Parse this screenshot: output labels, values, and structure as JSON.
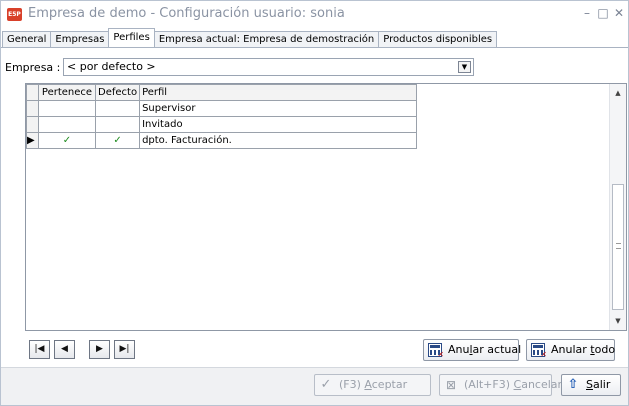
{
  "window": {
    "app_icon_text": "E5P",
    "title": "Empresa de demo - Configuración usuario: sonia",
    "minimize_glyph": "–",
    "maximize_glyph": "□",
    "close_glyph": "✕"
  },
  "tabs": [
    {
      "label": "General",
      "active": false
    },
    {
      "label": "Empresas",
      "active": false
    },
    {
      "label": "Perfiles",
      "active": true
    },
    {
      "label": "Empresa actual: Empresa de demostración",
      "active": false
    },
    {
      "label": "Productos disponibles",
      "active": false
    }
  ],
  "filter": {
    "label": "Empresa :",
    "value": "< por defecto >"
  },
  "grid": {
    "columns": [
      "Pertenece",
      "Defecto",
      "Perfil"
    ],
    "rows": [
      {
        "pertenece": "",
        "defecto": "",
        "perfil": "Supervisor",
        "current": false
      },
      {
        "pertenece": "",
        "defecto": "",
        "perfil": "Invitado",
        "current": false
      },
      {
        "pertenece": "✓",
        "defecto": "✓",
        "perfil": "dpto. Facturación.",
        "current": true
      }
    ],
    "current_row_marker": "▶"
  },
  "navigator": {
    "first": "|◀",
    "prev": "◀",
    "next": "▶",
    "last": "▶|"
  },
  "actions": {
    "anular_actual_pre": "Anu",
    "anular_actual_key": "l",
    "anular_actual_post": "ar actual",
    "anular_todo_pre": "Anular ",
    "anular_todo_key": "t",
    "anular_todo_post": "odo"
  },
  "footer": {
    "accept_pre": "(F3) ",
    "accept_key": "A",
    "accept_post": "ceptar",
    "cancel_pre": "(Alt+F3) ",
    "cancel_key": "C",
    "cancel_post": "ancelar",
    "exit_key": "S",
    "exit_post": "alir"
  }
}
